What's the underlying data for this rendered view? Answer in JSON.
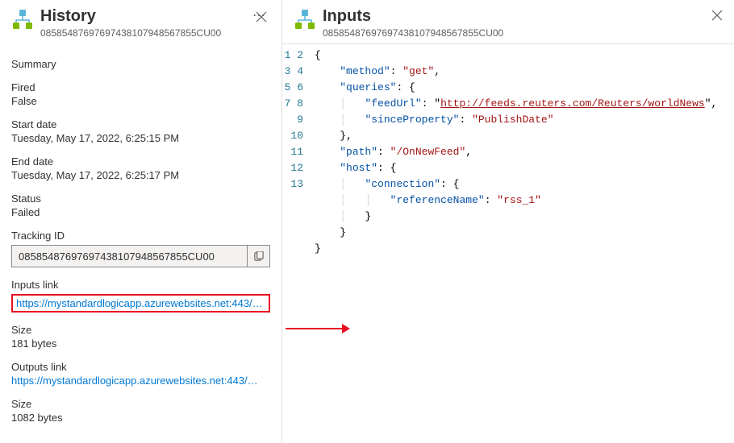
{
  "history": {
    "title": "History",
    "subtitle": "08585487697697438107948567855CU00",
    "summary_label": "Summary",
    "fired_label": "Fired",
    "fired_value": "False",
    "start_label": "Start date",
    "start_value": "Tuesday, May 17, 2022, 6:25:15 PM",
    "end_label": "End date",
    "end_value": "Tuesday, May 17, 2022, 6:25:17 PM",
    "status_label": "Status",
    "status_value": "Failed",
    "tracking_label": "Tracking ID",
    "tracking_value": "08585487697697438107948567855CU00",
    "inputs_link_label": "Inputs link",
    "inputs_link_value": "https://mystandardlogicapp.azurewebsites.net:443/…",
    "inputs_size_label": "Size",
    "inputs_size_value": "181 bytes",
    "outputs_link_label": "Outputs link",
    "outputs_link_value": "https://mystandardlogicapp.azurewebsites.net:443/…",
    "outputs_size_label": "Size",
    "outputs_size_value": "1082 bytes"
  },
  "inputs": {
    "title": "Inputs",
    "subtitle": "08585487697697438107948567855CU00",
    "json": {
      "method": "get",
      "queries": {
        "feedUrl": "http://feeds.reuters.com/Reuters/worldNews",
        "sinceProperty": "PublishDate"
      },
      "path": "/OnNewFeed",
      "host": {
        "connection": {
          "referenceName": "rss_1"
        }
      }
    }
  },
  "colors": {
    "link": "#0078d4",
    "highlight": "#e81123"
  }
}
